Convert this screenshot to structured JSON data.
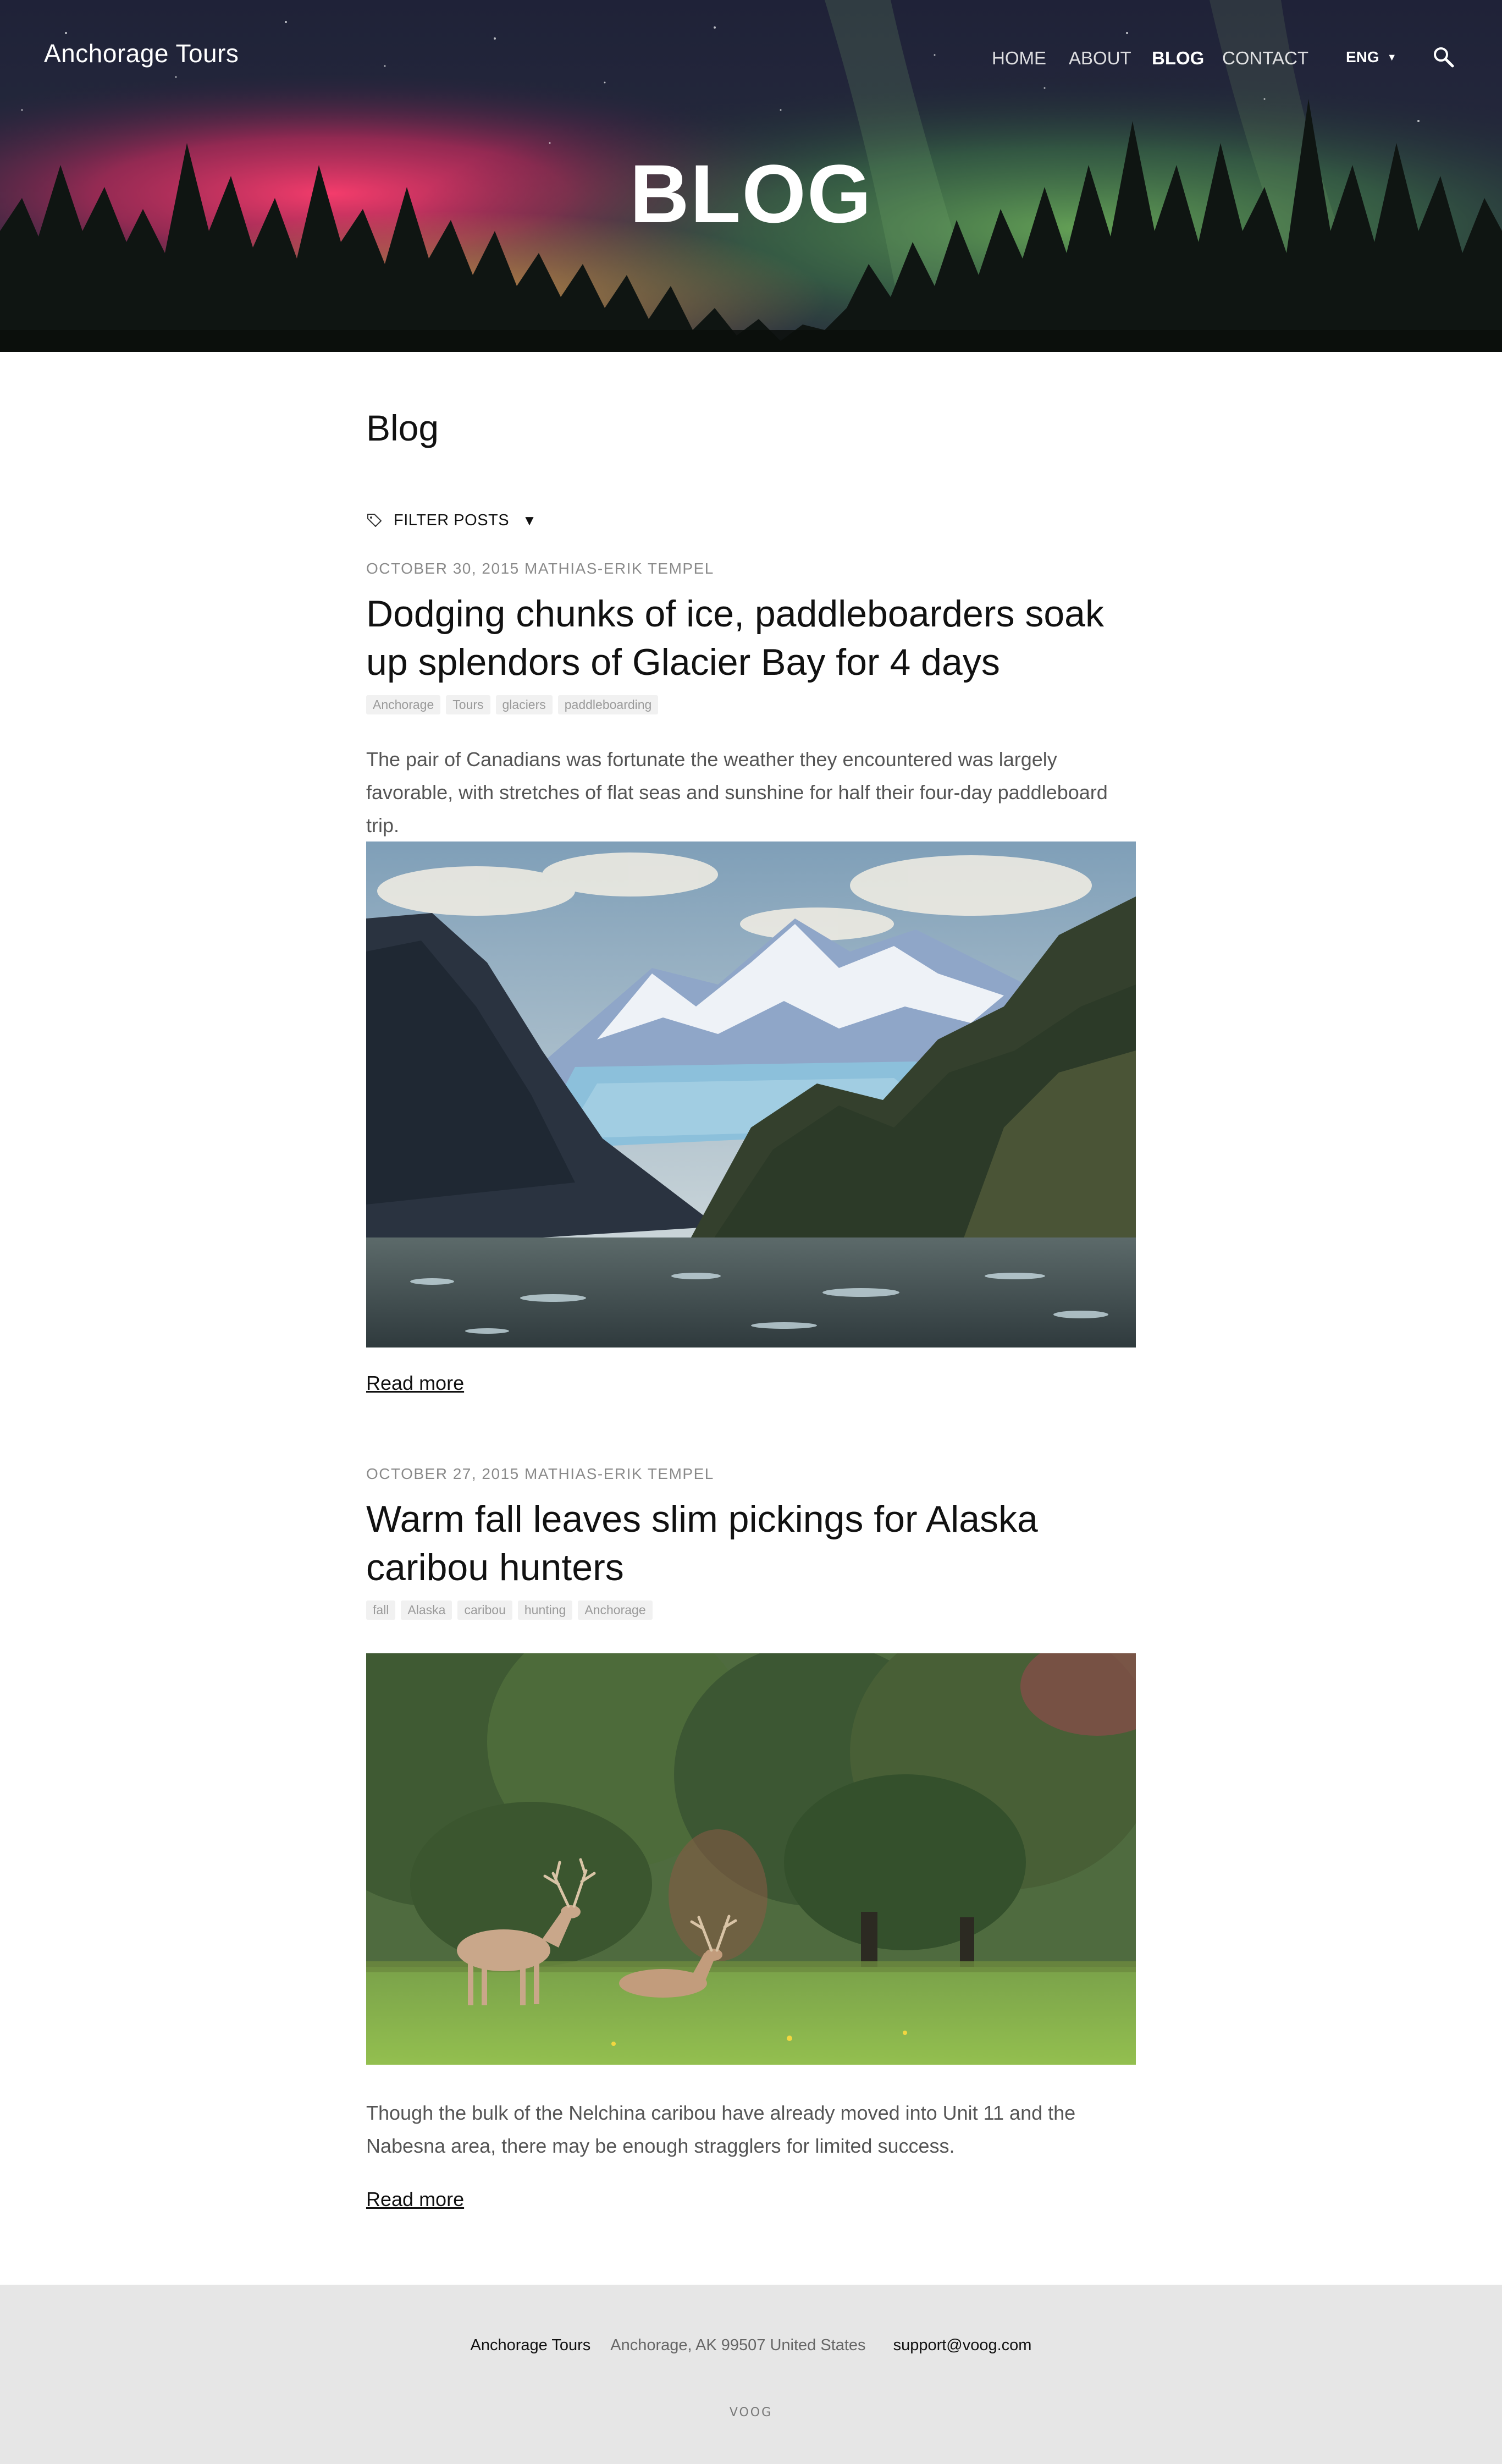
{
  "site": {
    "title": "Anchorage Tours"
  },
  "nav": {
    "items": [
      "HOME",
      "ABOUT",
      "BLOG",
      "CONTACT"
    ],
    "active": "BLOG",
    "language": "ENG"
  },
  "hero": {
    "heading": "BLOG"
  },
  "page": {
    "title": "Blog",
    "filter_label": "FILTER POSTS"
  },
  "posts": [
    {
      "meta": "OCTOBER 30, 2015 MATHIAS-ERIK TEMPEL",
      "title": "Dodging chunks of ice, paddleboarders soak up splendors of Glacier Bay for 4 days",
      "tags": [
        "Anchorage",
        "Tours",
        "glaciers",
        "paddleboarding"
      ],
      "excerpt": "The pair of Canadians was fortunate the weather they encountered was largely favorable, with stretches of flat seas and sunshine for half their four-day paddleboard trip.",
      "read_more": "Read more"
    },
    {
      "meta": "OCTOBER 27, 2015 MATHIAS-ERIK TEMPEL",
      "title": "Warm fall leaves slim pickings for Alaska caribou hunters",
      "tags": [
        "fall",
        "Alaska",
        "caribou",
        "hunting",
        "Anchorage"
      ],
      "excerpt": "Though the bulk of the Nelchina caribou have already moved into Unit 11 and the Nabesna area, there may be enough stragglers for limited success.",
      "read_more": "Read more"
    }
  ],
  "footer": {
    "brand": "Anchorage Tours",
    "address": "Anchorage, AK 99507 United States",
    "email": "support@voog.com",
    "logo_text": "VOOG"
  },
  "icons": {
    "search": "search-icon",
    "tag": "tag-icon",
    "caret": "caret-down-icon"
  },
  "colors": {
    "accent_text": "#111111",
    "muted_text": "#8a8a8a",
    "footer_bg": "#e6e6e6"
  }
}
